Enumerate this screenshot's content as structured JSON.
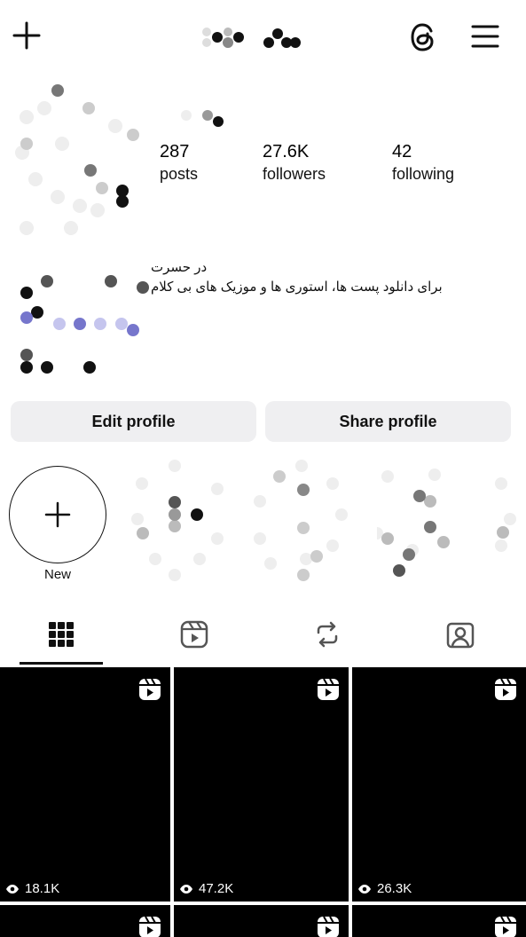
{
  "header": {
    "create_icon": "plus-icon",
    "threads_icon": "threads-icon",
    "menu_icon": "hamburger-menu-icon"
  },
  "stats": [
    {
      "value": "287",
      "label": "posts"
    },
    {
      "value": "27.6K",
      "label": "followers"
    },
    {
      "value": "42",
      "label": "following"
    }
  ],
  "bio": {
    "name": "در حسرت",
    "description": "برای دانلود پست ها، استوری ها و موزیک های بی کلام"
  },
  "buttons": {
    "edit": "Edit profile",
    "share": "Share profile"
  },
  "highlights": {
    "new_label": "New"
  },
  "tabs": [
    {
      "icon": "grid-icon",
      "active": true
    },
    {
      "icon": "reels-icon",
      "active": false
    },
    {
      "icon": "reposts-icon",
      "active": false
    },
    {
      "icon": "tagged-icon",
      "active": false
    }
  ],
  "grid": {
    "tiles": [
      {
        "views": "18.1K"
      },
      {
        "views": "47.2K"
      },
      {
        "views": "26.3K"
      }
    ]
  },
  "colors": {
    "button_bg": "#efeff1",
    "tile_bg": "#000000",
    "accent_underline": "#111111"
  }
}
